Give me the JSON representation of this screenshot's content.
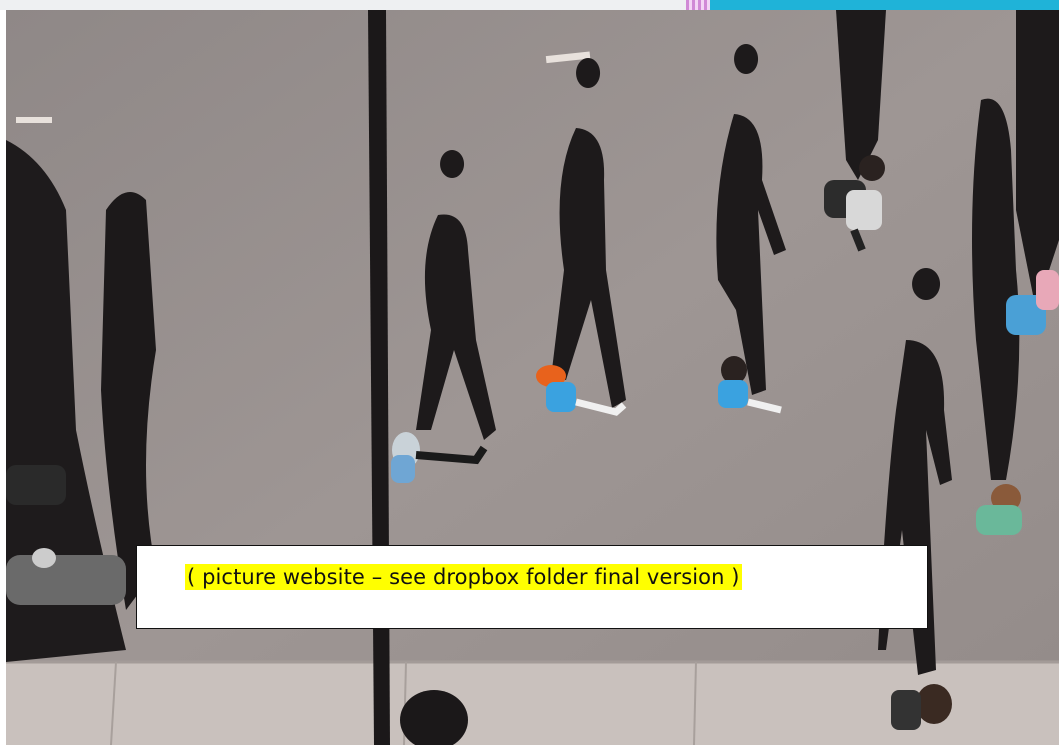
{
  "caption": {
    "text": "( picture website – see dropbox folder final version )",
    "highlight_color": "#ffff00"
  },
  "header_accents": {
    "strip_color": "#eef0f2",
    "pink_color": "#d08ad6",
    "cyan_color": "#1fb3d8"
  },
  "photo": {
    "subject": "aerial view of pedestrians walking on asphalt with long shadows",
    "icon": "photo-image"
  }
}
